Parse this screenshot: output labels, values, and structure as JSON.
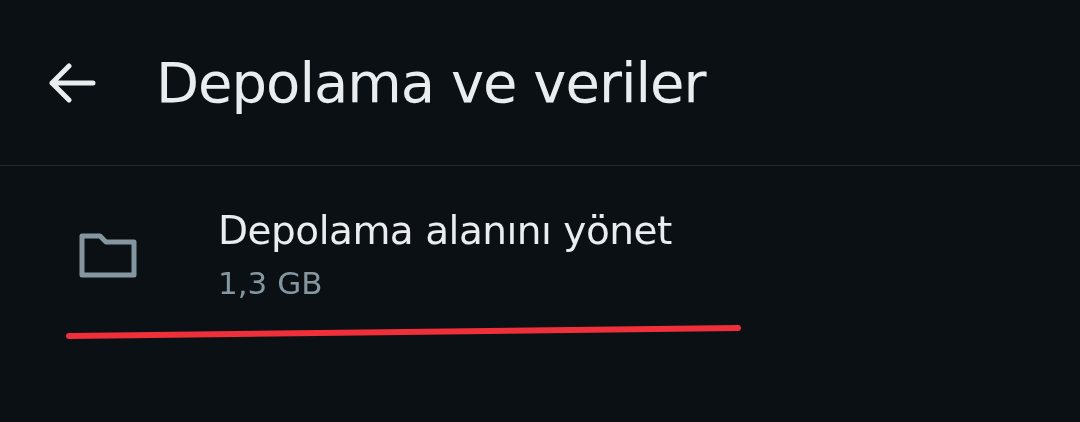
{
  "header": {
    "title": "Depolama ve veriler"
  },
  "items": [
    {
      "title": "Depolama alanını yönet",
      "subtitle": "1,3 GB"
    }
  ]
}
